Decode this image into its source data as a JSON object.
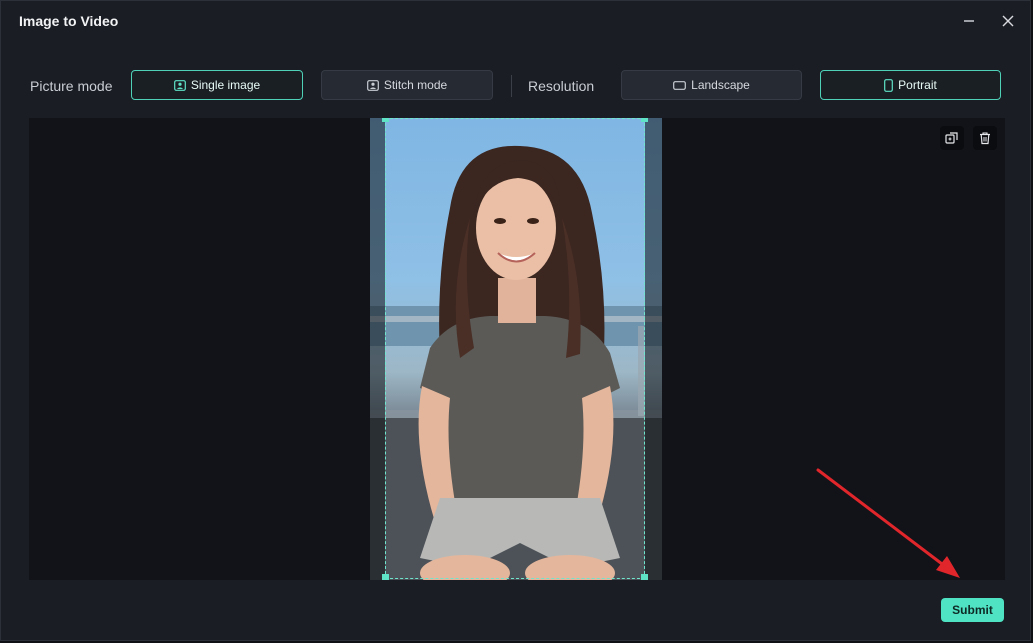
{
  "window": {
    "title": "Image to Video"
  },
  "toolbar": {
    "picture_mode_label": "Picture mode",
    "single_image_label": "Single image",
    "stitch_mode_label": "Stitch mode",
    "resolution_label": "Resolution",
    "landscape_label": "Landscape",
    "portrait_label": "Portrait",
    "selected_picture_mode": "Single image",
    "selected_resolution": "Portrait"
  },
  "canvas": {
    "image_tools": [
      "replace-icon",
      "trash-icon"
    ]
  },
  "footer": {
    "submit_label": "Submit"
  },
  "colors": {
    "accent": "#4fe3c4",
    "active_border": "#4fd1b8",
    "annotation_arrow": "#e0262b"
  }
}
